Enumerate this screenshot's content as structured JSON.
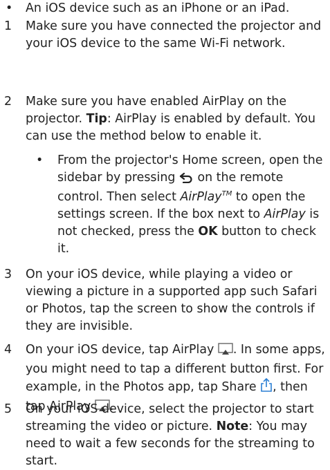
{
  "items": [
    {
      "marker": "•",
      "text": "An iOS device such as an iPhone or an iPad."
    },
    {
      "marker": "1",
      "text": "Make sure you have connected the projector and your iOS device to the same Wi-Fi network."
    },
    {
      "marker": "2",
      "t1": "Make sure you have enabled AirPlay on the projector. ",
      "tip_label": "Tip",
      "t2": ": AirPlay is enabled by default. You can use the method below to enable it."
    },
    {
      "marker": "•",
      "s1": "From the projector's Home screen, open the sidebar by pressing ",
      "s2": " on the remote control. Then select ",
      "airplay_tm": "AirPlay",
      "tm": "TM",
      "s3": " to open the settings screen. If the box next to ",
      "airplay": "AirPlay",
      "s4": " is not checked, press the ",
      "ok": "OK",
      "s5": " button to check it."
    },
    {
      "marker": "3",
      "text": "On your iOS device, while playing a video or viewing a picture in a supported app such Safari or Photos, tap the screen to show the controls if they are invisible."
    },
    {
      "marker": "4",
      "t1": "On your iOS device, tap AirPlay ",
      "t2": ". In some apps, you might need to tap a different button first. For example, in the Photos app, tap Share ",
      "t3": ", then tap AirPlay ",
      "t4": "."
    },
    {
      "marker": "5",
      "t1": "On your iOS device, select the projector to start streaming the video or picture. ",
      "note_label": "Note",
      "t2": ": You may need to wait a few seconds for the streaming to start."
    }
  ],
  "icons": [
    "back-arrow-icon",
    "airplay-icon",
    "share-icon"
  ]
}
